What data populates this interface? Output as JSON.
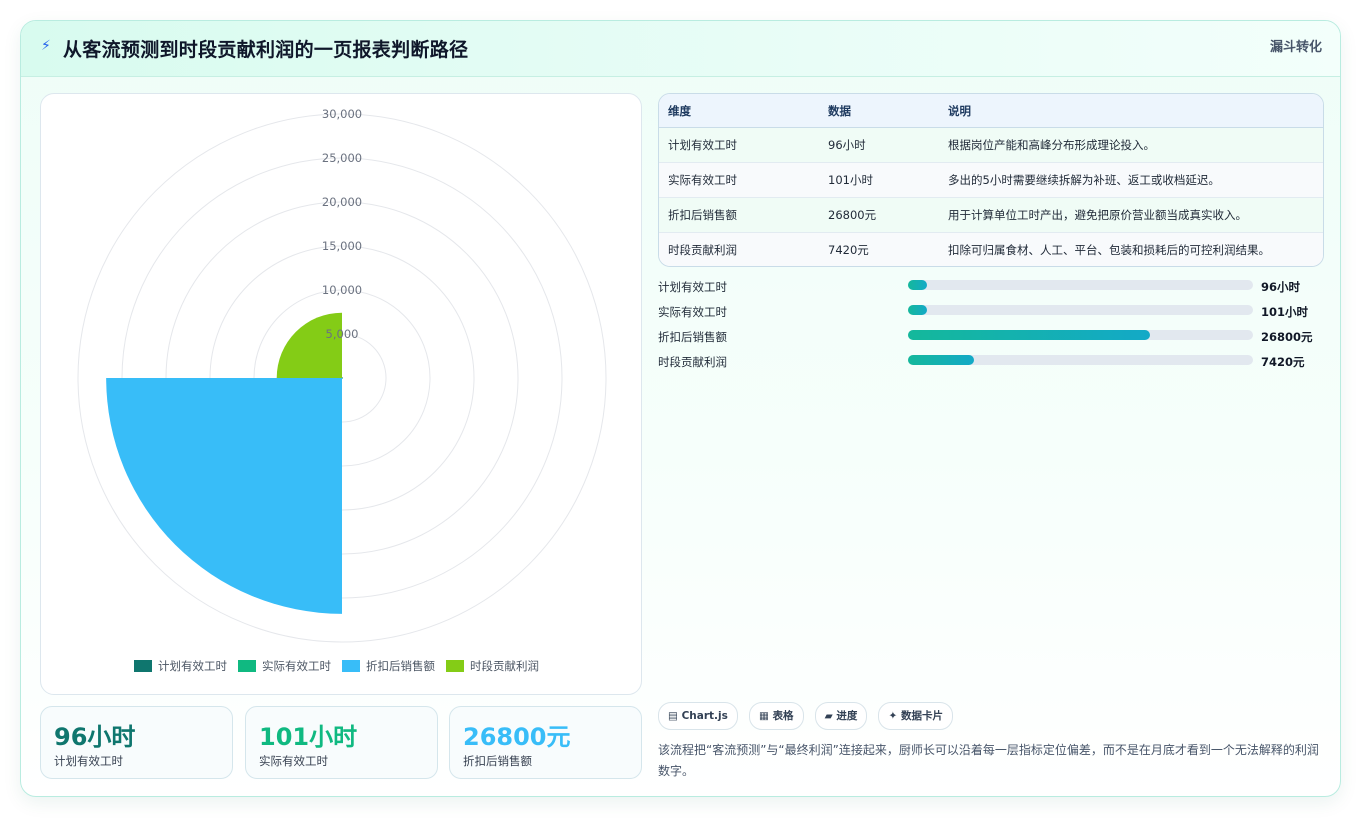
{
  "header": {
    "icon": "bolt-icon",
    "title": "从客流预测到时段贡献利润的一页报表判断路径",
    "tag": "漏斗转化"
  },
  "chart_data": {
    "type": "polarArea",
    "categories": [
      "计划有效工时",
      "实际有效工时",
      "折扣后销售额",
      "时段贡献利润"
    ],
    "values": [
      96,
      101,
      26800,
      7420
    ],
    "colors": [
      "#0f766e",
      "#10b981",
      "#38bdf8",
      "#84cc16"
    ],
    "r_axis": {
      "min": 0,
      "max": 30000,
      "ticks": [
        "30,000",
        "25,000",
        "20,000",
        "15,000",
        "10,000",
        "5,000"
      ]
    },
    "legend_position": "bottom",
    "grid": true
  },
  "kpis": [
    {
      "value": "96小时",
      "label": "计划有效工时",
      "color": "#0f766e"
    },
    {
      "value": "101小时",
      "label": "实际有效工时",
      "color": "#10b981"
    },
    {
      "value": "26800元",
      "label": "折扣后销售额",
      "color": "#38bdf8"
    }
  ],
  "table": {
    "headers": [
      "维度",
      "数据",
      "说明"
    ],
    "rows": [
      [
        "计划有效工时",
        "96小时",
        "根据岗位产能和高峰分布形成理论投入。"
      ],
      [
        "实际有效工时",
        "101小时",
        "多出的5小时需要继续拆解为补班、返工或收档延迟。"
      ],
      [
        "折扣后销售额",
        "26800元",
        "用于计算单位工时产出，避免把原价营业额当成真实收入。"
      ],
      [
        "时段贡献利润",
        "7420元",
        "扣除可归属食材、人工、平台、包装和损耗后的可控利润结果。"
      ]
    ]
  },
  "progress": [
    {
      "label": "计划有效工时",
      "value": "96小时",
      "fraction": 0.055
    },
    {
      "label": "实际有效工时",
      "value": "101小时",
      "fraction": 0.055
    },
    {
      "label": "折扣后销售额",
      "value": "26800元",
      "fraction": 0.7
    },
    {
      "label": "时段贡献利润",
      "value": "7420元",
      "fraction": 0.19
    }
  ],
  "chips": [
    "Chart.js",
    "表格",
    "进度",
    "数据卡片"
  ],
  "note": "该流程把“客流预测”与“最终利润”连接起来，厨师长可以沿着每一层指标定位偏差，而不是在月底才看到一个无法解释的利润数字。"
}
